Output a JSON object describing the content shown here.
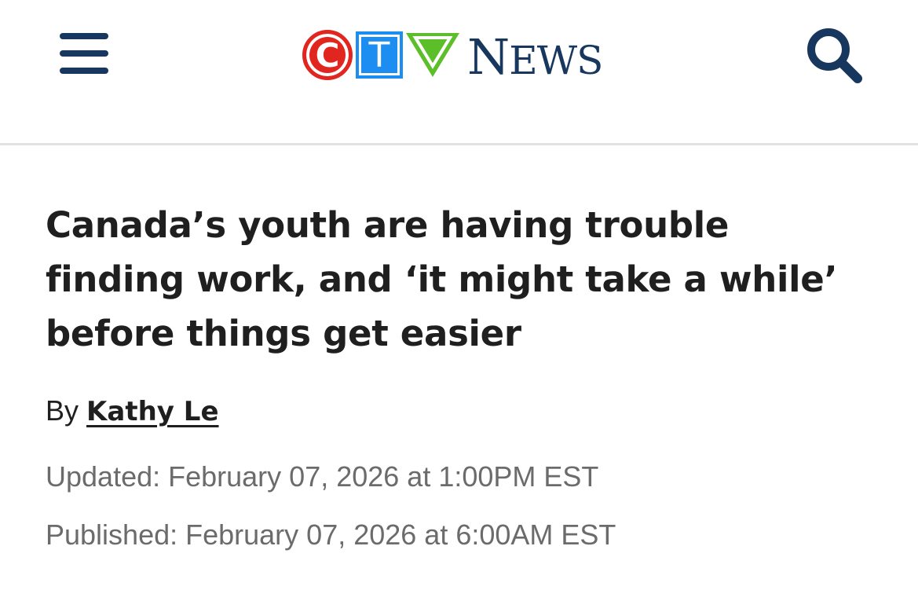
{
  "header": {
    "logo": {
      "c": "C",
      "t": "T",
      "v": "V",
      "news_first": "N",
      "news_rest": "EWS"
    },
    "icons": {
      "menu": "hamburger-menu-icon",
      "search": "search-icon"
    },
    "colors": {
      "navy": "#17375e",
      "red": "#e0261e",
      "blue": "#1c8ef2",
      "green": "#5cbf2a"
    }
  },
  "article": {
    "headline": "Canada’s youth are having trouble finding work, and ‘it might take a while’ before things get easier",
    "byline_prefix": "By",
    "author": "Kathy Le",
    "updated": "Updated: February 07, 2026 at 1:00PM EST",
    "published": "Published: February 07, 2026 at 6:00AM EST"
  }
}
